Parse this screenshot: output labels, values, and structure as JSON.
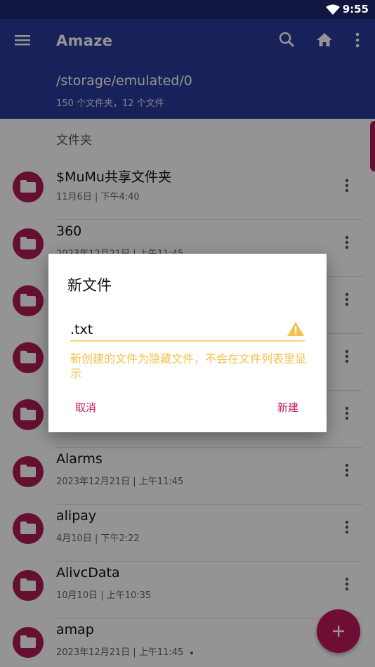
{
  "status": {
    "time": "9:55"
  },
  "appbar": {
    "title": "Amaze",
    "path": "/storage/emulated/0",
    "count": "150 个文件夹，12 个文件"
  },
  "list": {
    "section": "文件夹",
    "items": [
      {
        "name": "$MuMu共享文件夹",
        "date": "11月6日 | 下午4:40"
      },
      {
        "name": "360",
        "date": "2023年12月21日 | 上午11:45"
      },
      {
        "name": "",
        "date": ""
      },
      {
        "name": "",
        "date": ""
      },
      {
        "name": "",
        "date": ""
      },
      {
        "name": "Alarms",
        "date": "2023年12月21日 | 上午11:45"
      },
      {
        "name": "alipay",
        "date": "4月10日 | 下午2:22"
      },
      {
        "name": "AlivcData",
        "date": "10月10日 | 上午10:35"
      },
      {
        "name": "amap",
        "date": "2023年12月21日 | 上午11:45"
      }
    ]
  },
  "dialog": {
    "title": "新文件",
    "input_value": ".txt",
    "warning": "新创建的文件为隐藏文件，不会在文件列表里显示",
    "cancel": "取消",
    "create": "新建"
  },
  "colors": {
    "appbar": "#2a3a9c",
    "accent": "#c2185b",
    "warning": "#f2c24a"
  }
}
